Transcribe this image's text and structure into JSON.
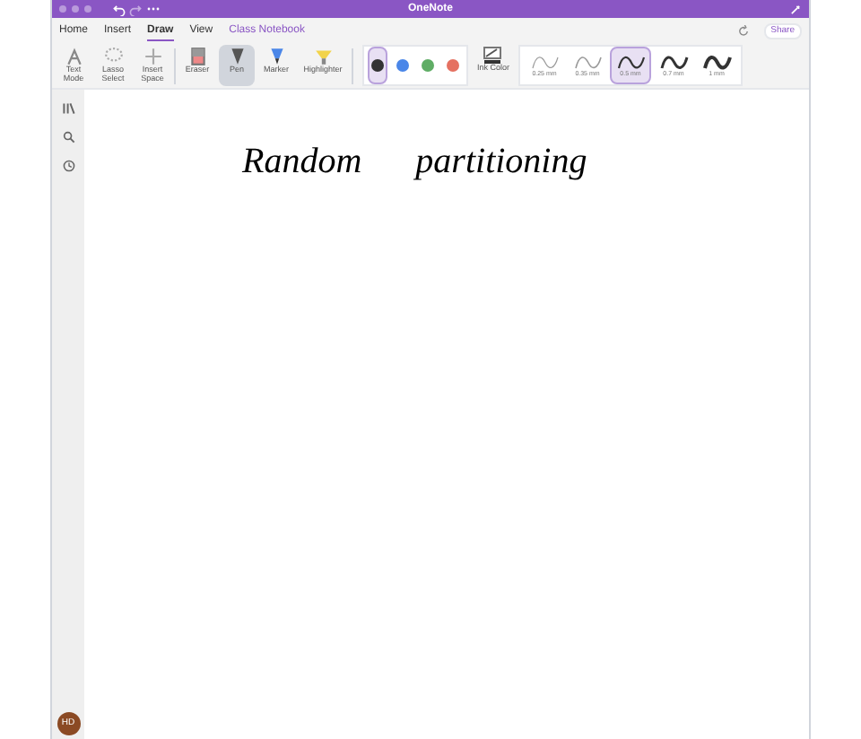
{
  "window": {
    "title": "OneNote"
  },
  "tabs": [
    {
      "label": "Home",
      "selected": false,
      "kind": "plain"
    },
    {
      "label": "Insert",
      "selected": false,
      "kind": "plain"
    },
    {
      "label": "Draw",
      "selected": true,
      "kind": "plain"
    },
    {
      "label": "View",
      "selected": false,
      "kind": "plain"
    },
    {
      "label": "Class Notebook",
      "selected": false,
      "kind": "accent"
    }
  ],
  "share": "Share",
  "tools": [
    {
      "label": "Text Mode",
      "kind": "text",
      "selected": false
    },
    {
      "label": "Lasso Select",
      "kind": "lasso",
      "selected": false
    },
    {
      "label": "Insert Space",
      "kind": "space",
      "selected": false
    },
    {
      "label": "Eraser",
      "kind": "eraser",
      "selected": false
    },
    {
      "label": "Pen",
      "kind": "pen",
      "selected": true
    },
    {
      "label": "Marker",
      "kind": "marker",
      "selected": false
    },
    {
      "label": "Highlighter",
      "kind": "highlighter",
      "selected": false
    }
  ],
  "pen_colors": [
    {
      "color": "#333333",
      "selected": true
    },
    {
      "color": "#4a86e8",
      "selected": false
    },
    {
      "color": "#5fad65",
      "selected": false
    },
    {
      "color": "#e57161",
      "selected": false
    }
  ],
  "ink_color": "Ink Color",
  "pen_widths": [
    {
      "label": "0.25 mm",
      "selected": false
    },
    {
      "label": "0.35 mm",
      "selected": false
    },
    {
      "label": "0.5 mm",
      "selected": true
    },
    {
      "label": "0.7 mm",
      "selected": false
    },
    {
      "label": "1 mm",
      "selected": false
    }
  ],
  "page": {
    "ink_text": [
      "Random",
      "partitioning"
    ]
  },
  "user": {
    "initials": "HD"
  }
}
